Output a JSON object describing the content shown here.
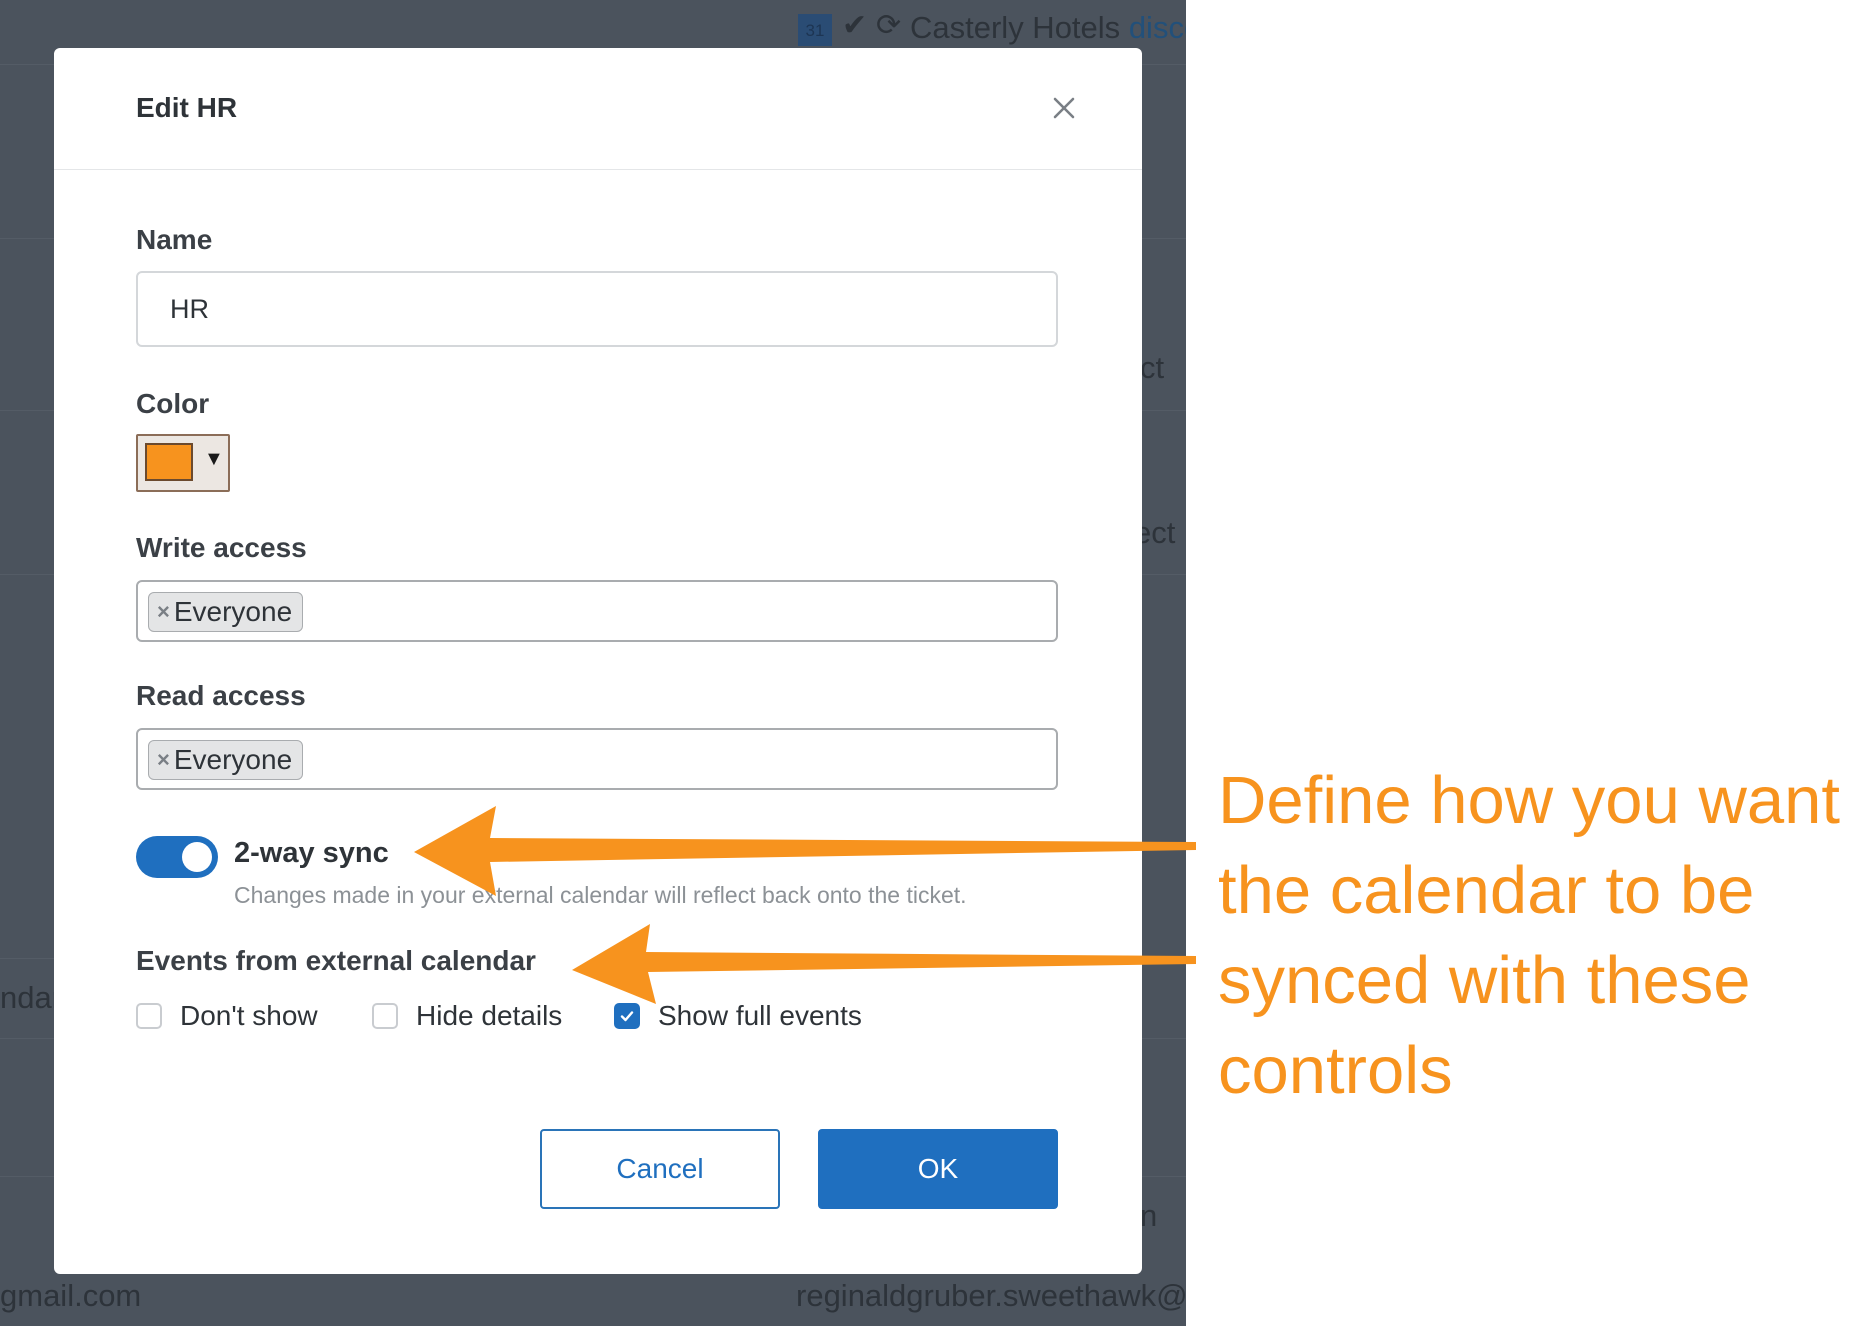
{
  "background": {
    "top_text": "Casterly Hotels",
    "top_link": "disco",
    "cal_badge": "31",
    "fragment_1": "ct",
    "fragment_2": "ect",
    "fragment_3": "ndar",
    "fragment_4": "n",
    "email_left": "gmail.com",
    "email_right": "reginaldgruber.sweethawk@gr"
  },
  "modal": {
    "title": "Edit HR",
    "name_label": "Name",
    "name_value": "HR",
    "color_label": "Color",
    "color_value": "#f7931e",
    "write_access_label": "Write access",
    "write_access_tag": "Everyone",
    "read_access_label": "Read access",
    "read_access_tag": "Everyone",
    "sync_toggle": {
      "label": "2-way sync",
      "on": true,
      "helper": "Changes made in your external calendar will reflect back onto the ticket."
    },
    "events_label": "Events from external calendar",
    "event_options": [
      {
        "label": "Don't show",
        "checked": false
      },
      {
        "label": "Hide details",
        "checked": false
      },
      {
        "label": "Show full events",
        "checked": true
      }
    ],
    "cancel_label": "Cancel",
    "ok_label": "OK"
  },
  "annotation": {
    "text": "Define how you want the calendar to be synced with these controls",
    "color": "#f7931e"
  },
  "colors": {
    "primary": "#1f6fbf",
    "annotation_orange": "#f7931e",
    "overlay": "#4b535d"
  }
}
